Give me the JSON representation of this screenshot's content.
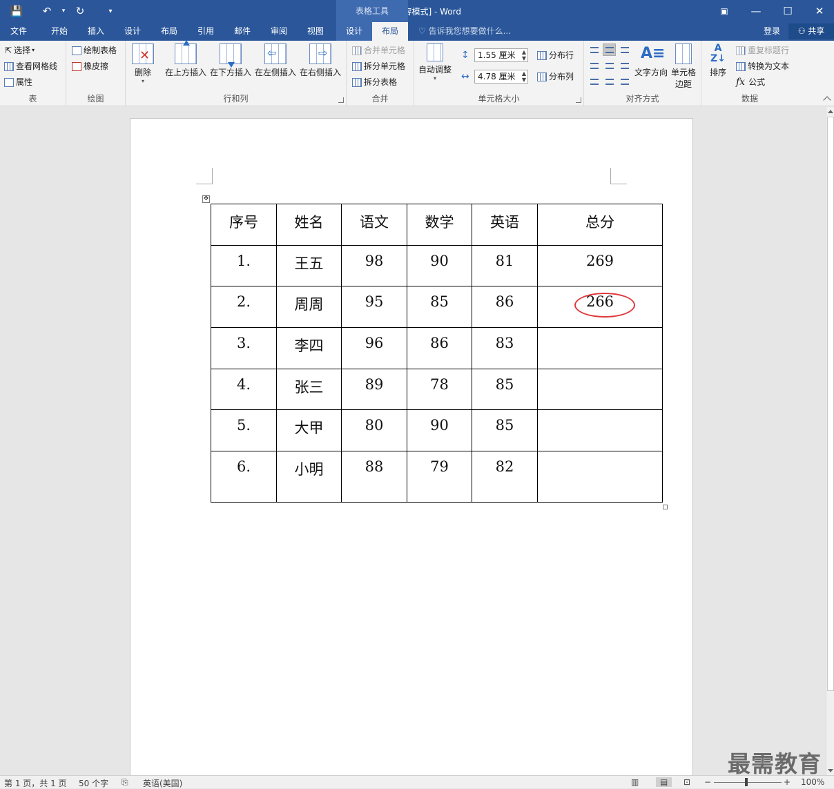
{
  "titlebar": {
    "title": "序号 [兼容模式] - Word",
    "context_group": "表格工具",
    "save_icon": "💾",
    "undo_icon": "↶",
    "redo_icon": "↻",
    "customize_icon": "▾",
    "restore_icon": "▣",
    "minimize_icon": "—",
    "maximize_icon": "☐",
    "close_icon": "✕"
  },
  "tabs": {
    "file": "文件",
    "home": "开始",
    "insert": "插入",
    "design": "设计",
    "layout": "布局",
    "references": "引用",
    "mailings": "邮件",
    "review": "审阅",
    "view": "视图",
    "table_design": "设计",
    "table_layout": "布局",
    "tell_me": "告诉我您想要做什么...",
    "login": "登录",
    "share": "共享"
  },
  "ribbon": {
    "table": {
      "label": "表",
      "select": "选择",
      "gridlines": "查看网格线",
      "properties": "属性"
    },
    "draw": {
      "label": "绘图",
      "draw_table": "绘制表格",
      "eraser": "橡皮擦"
    },
    "rows_cols": {
      "label": "行和列",
      "delete": "删除",
      "insert_above": "在上方插入",
      "insert_below": "在下方插入",
      "insert_left": "在左侧插入",
      "insert_right": "在右侧插入"
    },
    "merge": {
      "label": "合并",
      "merge_cells": "合并单元格",
      "split_cells": "拆分单元格",
      "split_table": "拆分表格"
    },
    "cell_size": {
      "label": "单元格大小",
      "autofit": "自动调整",
      "height": "1.55 厘米",
      "width": "4.78 厘米",
      "distribute_rows": "分布行",
      "distribute_cols": "分布列"
    },
    "alignment": {
      "label": "对齐方式",
      "text_direction": "文字方向",
      "cell_margins_1": "单元格",
      "cell_margins_2": "边距"
    },
    "data": {
      "label": "数据",
      "sort": "排序",
      "repeat_header": "重复标题行",
      "convert_to_text": "转换为文本",
      "formula": "公式",
      "formula_icon": "fx"
    }
  },
  "table": {
    "headers": [
      "序号",
      "姓名",
      "语文",
      "数学",
      "英语",
      "总分"
    ],
    "rows": [
      [
        "1.",
        "王五",
        "98",
        "90",
        "81",
        "269"
      ],
      [
        "2.",
        "周周",
        "95",
        "85",
        "86",
        "266"
      ],
      [
        "3.",
        "李四",
        "96",
        "86",
        "83",
        ""
      ],
      [
        "4.",
        "张三",
        "89",
        "78",
        "85",
        ""
      ],
      [
        "5.",
        "大甲",
        "80",
        "90",
        "85",
        ""
      ],
      [
        "6.",
        "小明",
        "88",
        "79",
        "82",
        ""
      ]
    ],
    "move_handle": "✥"
  },
  "status": {
    "page": "第 1 页，共 1 页",
    "words": "50 个字",
    "language": "英语(美国)",
    "zoom": "100%"
  },
  "watermark": "最需教育"
}
